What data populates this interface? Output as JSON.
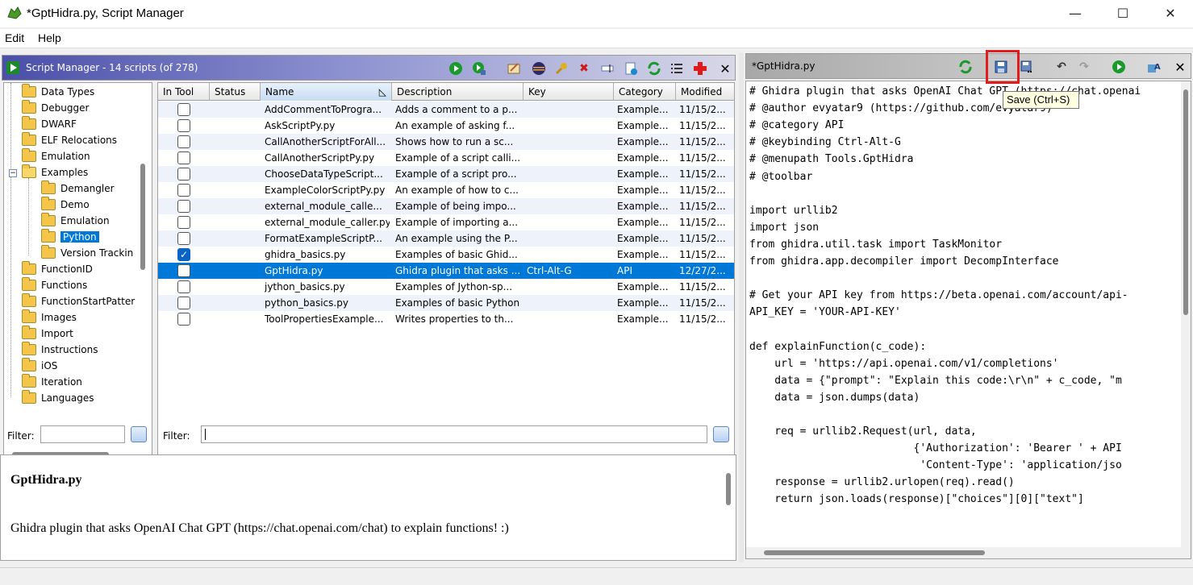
{
  "window": {
    "title": "*GptHidra.py, Script Manager",
    "minimize": "—",
    "maximize": "☐",
    "close": "✕"
  },
  "menu": {
    "items": [
      "Edit",
      "Help"
    ]
  },
  "script_manager": {
    "title": "Script Manager - 14 scripts  (of 278)",
    "toolbar_icons": [
      "run-script-icon",
      "run-last-icon",
      "edit-script-icon",
      "eclipse-icon",
      "key-binding-icon",
      "delete-icon",
      "rename-icon",
      "new-script-icon",
      "refresh-icon",
      "list-icon",
      "add-icon",
      "close-icon"
    ],
    "tree": [
      {
        "label": "Data Types",
        "indent": 0
      },
      {
        "label": "Debugger",
        "indent": 0
      },
      {
        "label": "DWARF",
        "indent": 0
      },
      {
        "label": "ELF Relocations",
        "indent": 0
      },
      {
        "label": "Emulation",
        "indent": 0
      },
      {
        "label": "Examples",
        "indent": 0,
        "expanded": true
      },
      {
        "label": "Demangler",
        "indent": 1
      },
      {
        "label": "Demo",
        "indent": 1
      },
      {
        "label": "Emulation",
        "indent": 1
      },
      {
        "label": "Python",
        "indent": 1,
        "selected": true
      },
      {
        "label": "Version Trackin",
        "indent": 1
      },
      {
        "label": "FunctionID",
        "indent": 0
      },
      {
        "label": "Functions",
        "indent": 0
      },
      {
        "label": "FunctionStartPatter",
        "indent": 0
      },
      {
        "label": "Images",
        "indent": 0
      },
      {
        "label": "Import",
        "indent": 0
      },
      {
        "label": "Instructions",
        "indent": 0
      },
      {
        "label": "iOS",
        "indent": 0
      },
      {
        "label": "Iteration",
        "indent": 0
      },
      {
        "label": "Languages",
        "indent": 0
      }
    ],
    "columns": [
      "In Tool",
      "Status",
      "Name",
      "Description",
      "Key",
      "Category",
      "Modified"
    ],
    "rows": [
      {
        "in_tool": false,
        "name": "AddCommentToProgra...",
        "desc": "Adds a comment to a p...",
        "key": "",
        "category": "Example...",
        "modified": "11/15/2..."
      },
      {
        "in_tool": false,
        "name": "AskScriptPy.py",
        "desc": "An example of asking f...",
        "key": "",
        "category": "Example...",
        "modified": "11/15/2..."
      },
      {
        "in_tool": false,
        "name": "CallAnotherScriptForAll...",
        "desc": "Shows how to run a sc...",
        "key": "",
        "category": "Example...",
        "modified": "11/15/2..."
      },
      {
        "in_tool": false,
        "name": "CallAnotherScriptPy.py",
        "desc": "Example of a script calli...",
        "key": "",
        "category": "Example...",
        "modified": "11/15/2..."
      },
      {
        "in_tool": false,
        "name": "ChooseDataTypeScript...",
        "desc": "Example of a script pro...",
        "key": "",
        "category": "Example...",
        "modified": "11/15/2..."
      },
      {
        "in_tool": false,
        "name": "ExampleColorScriptPy.py",
        "desc": "An example of how to c...",
        "key": "",
        "category": "Example...",
        "modified": "11/15/2..."
      },
      {
        "in_tool": false,
        "name": "external_module_calle...",
        "desc": "Example of being impo...",
        "key": "",
        "category": "Example...",
        "modified": "11/15/2..."
      },
      {
        "in_tool": false,
        "name": "external_module_caller.py",
        "desc": "Example of importing a...",
        "key": "",
        "category": "Example...",
        "modified": "11/15/2..."
      },
      {
        "in_tool": false,
        "name": "FormatExampleScriptP...",
        "desc": "An example using the P...",
        "key": "",
        "category": "Example...",
        "modified": "11/15/2..."
      },
      {
        "in_tool": true,
        "name": "ghidra_basics.py",
        "desc": "Examples of basic Ghid...",
        "key": "",
        "category": "Example...",
        "modified": "11/15/2..."
      },
      {
        "in_tool": false,
        "name": "GptHidra.py",
        "desc": "Ghidra plugin that asks ...",
        "key": "Ctrl-Alt-G",
        "category": "API",
        "modified": "12/27/2...",
        "selected": true
      },
      {
        "in_tool": false,
        "name": "jython_basics.py",
        "desc": "Examples of Jython-sp...",
        "key": "",
        "category": "Example...",
        "modified": "11/15/2..."
      },
      {
        "in_tool": false,
        "name": "python_basics.py",
        "desc": "Examples of basic Python",
        "key": "",
        "category": "Example...",
        "modified": "11/15/2..."
      },
      {
        "in_tool": false,
        "name": "ToolPropertiesExample...",
        "desc": "Writes properties to th...",
        "key": "",
        "category": "Example...",
        "modified": "11/15/2..."
      }
    ],
    "tree_filter_label": "Filter:",
    "table_filter_label": "Filter:",
    "description": {
      "title": "GptHidra.py",
      "text": "Ghidra plugin that asks OpenAI Chat GPT (https://chat.openai.com/chat) to explain functions! :)"
    }
  },
  "editor": {
    "tab_title": "*GptHidra.py",
    "tooltip": "Save (Ctrl+S)",
    "toolbar_icons": [
      "refresh-icon",
      "save-icon",
      "save-as-icon",
      "undo-icon",
      "redo-icon",
      "run-icon",
      "font-icon",
      "close-icon"
    ],
    "code_lines": [
      "# Ghidra plugin that asks OpenAI Chat GPT (https://chat.openai",
      "# @author evyatar9 (https://github.com/evyatar9)",
      "# @category API",
      "# @keybinding Ctrl-Alt-G",
      "# @menupath Tools.GptHidra",
      "# @toolbar",
      "",
      "import urllib2",
      "import json",
      "from ghidra.util.task import TaskMonitor",
      "from ghidra.app.decompiler import DecompInterface",
      "",
      "# Get your API key from https://beta.openai.com/account/api-",
      "API_KEY = 'YOUR-API-KEY'",
      "",
      "def explainFunction(c_code):",
      "    url = 'https://api.openai.com/v1/completions'",
      "    data = {\"prompt\": \"Explain this code:\\r\\n\" + c_code, \"m",
      "    data = json.dumps(data)",
      "",
      "    req = urllib2.Request(url, data,",
      "                          {'Authorization': 'Bearer ' + API",
      "                           'Content-Type': 'application/jso",
      "    response = urllib2.urlopen(req).read()",
      "    return json.loads(response)[\"choices\"][0][\"text\"]"
    ]
  }
}
